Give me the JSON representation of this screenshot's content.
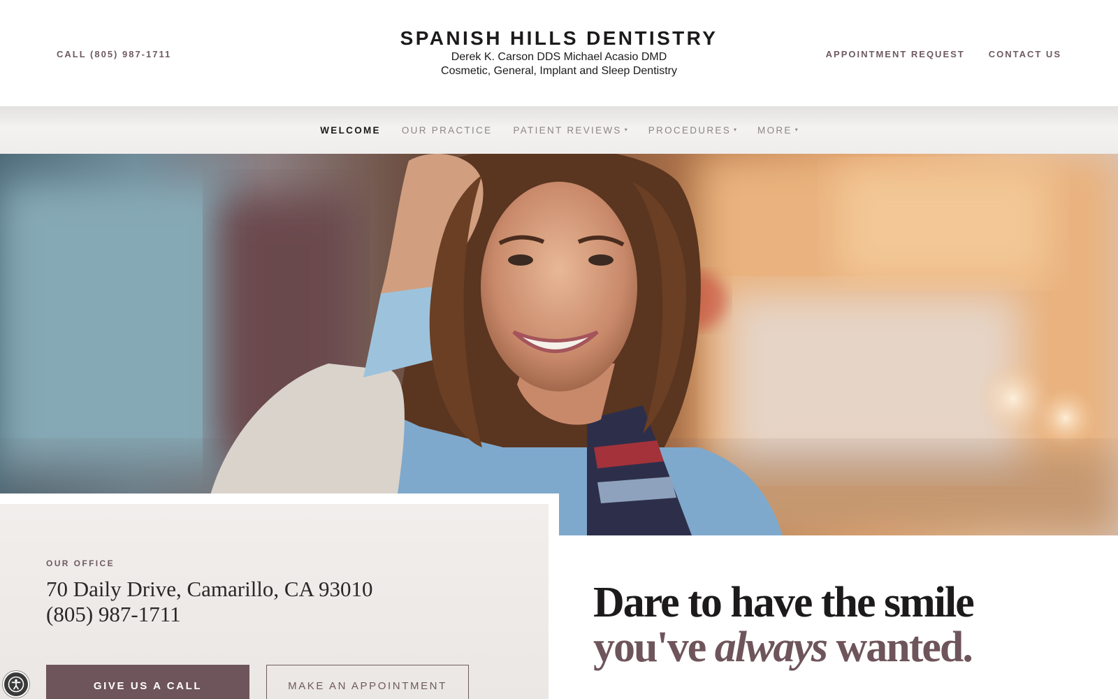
{
  "header": {
    "call_label": "CALL (805) 987-1711",
    "brand_title": "SPANISH HILLS DENTISTRY",
    "doctors": "Derek K. Carson DDS Michael Acasio DMD",
    "specialties": "Cosmetic, General, Implant and Sleep Dentistry",
    "links": [
      "APPOINTMENT REQUEST",
      "CONTACT US"
    ]
  },
  "nav": {
    "items": [
      {
        "label": "WELCOME",
        "active": true,
        "dropdown": false
      },
      {
        "label": "OUR PRACTICE",
        "active": false,
        "dropdown": false
      },
      {
        "label": "PATIENT REVIEWS",
        "active": false,
        "dropdown": true
      },
      {
        "label": "PROCEDURES",
        "active": false,
        "dropdown": true
      },
      {
        "label": "MORE",
        "active": false,
        "dropdown": true
      }
    ],
    "caret": "▾"
  },
  "office": {
    "label": "OUR OFFICE",
    "address": "70 Daily Drive, Camarillo, CA 93010",
    "phone": "(805) 987-1711",
    "call_button": "GIVE US A CALL",
    "appointment_button": "MAKE AN APPOINTMENT"
  },
  "tagline": {
    "line1": "Dare to have the smile",
    "line2_pre": "you've ",
    "line2_em": "always",
    "line2_post": " wanted."
  },
  "icons": {
    "accessibility": "accessibility-icon",
    "hero": "smiling-woman-photo"
  },
  "colors": {
    "brand_mauve": "#6e555b",
    "text_dark": "#1c1a1b",
    "nav_muted": "#8d8486",
    "card_bg": "#ebe7e4"
  }
}
